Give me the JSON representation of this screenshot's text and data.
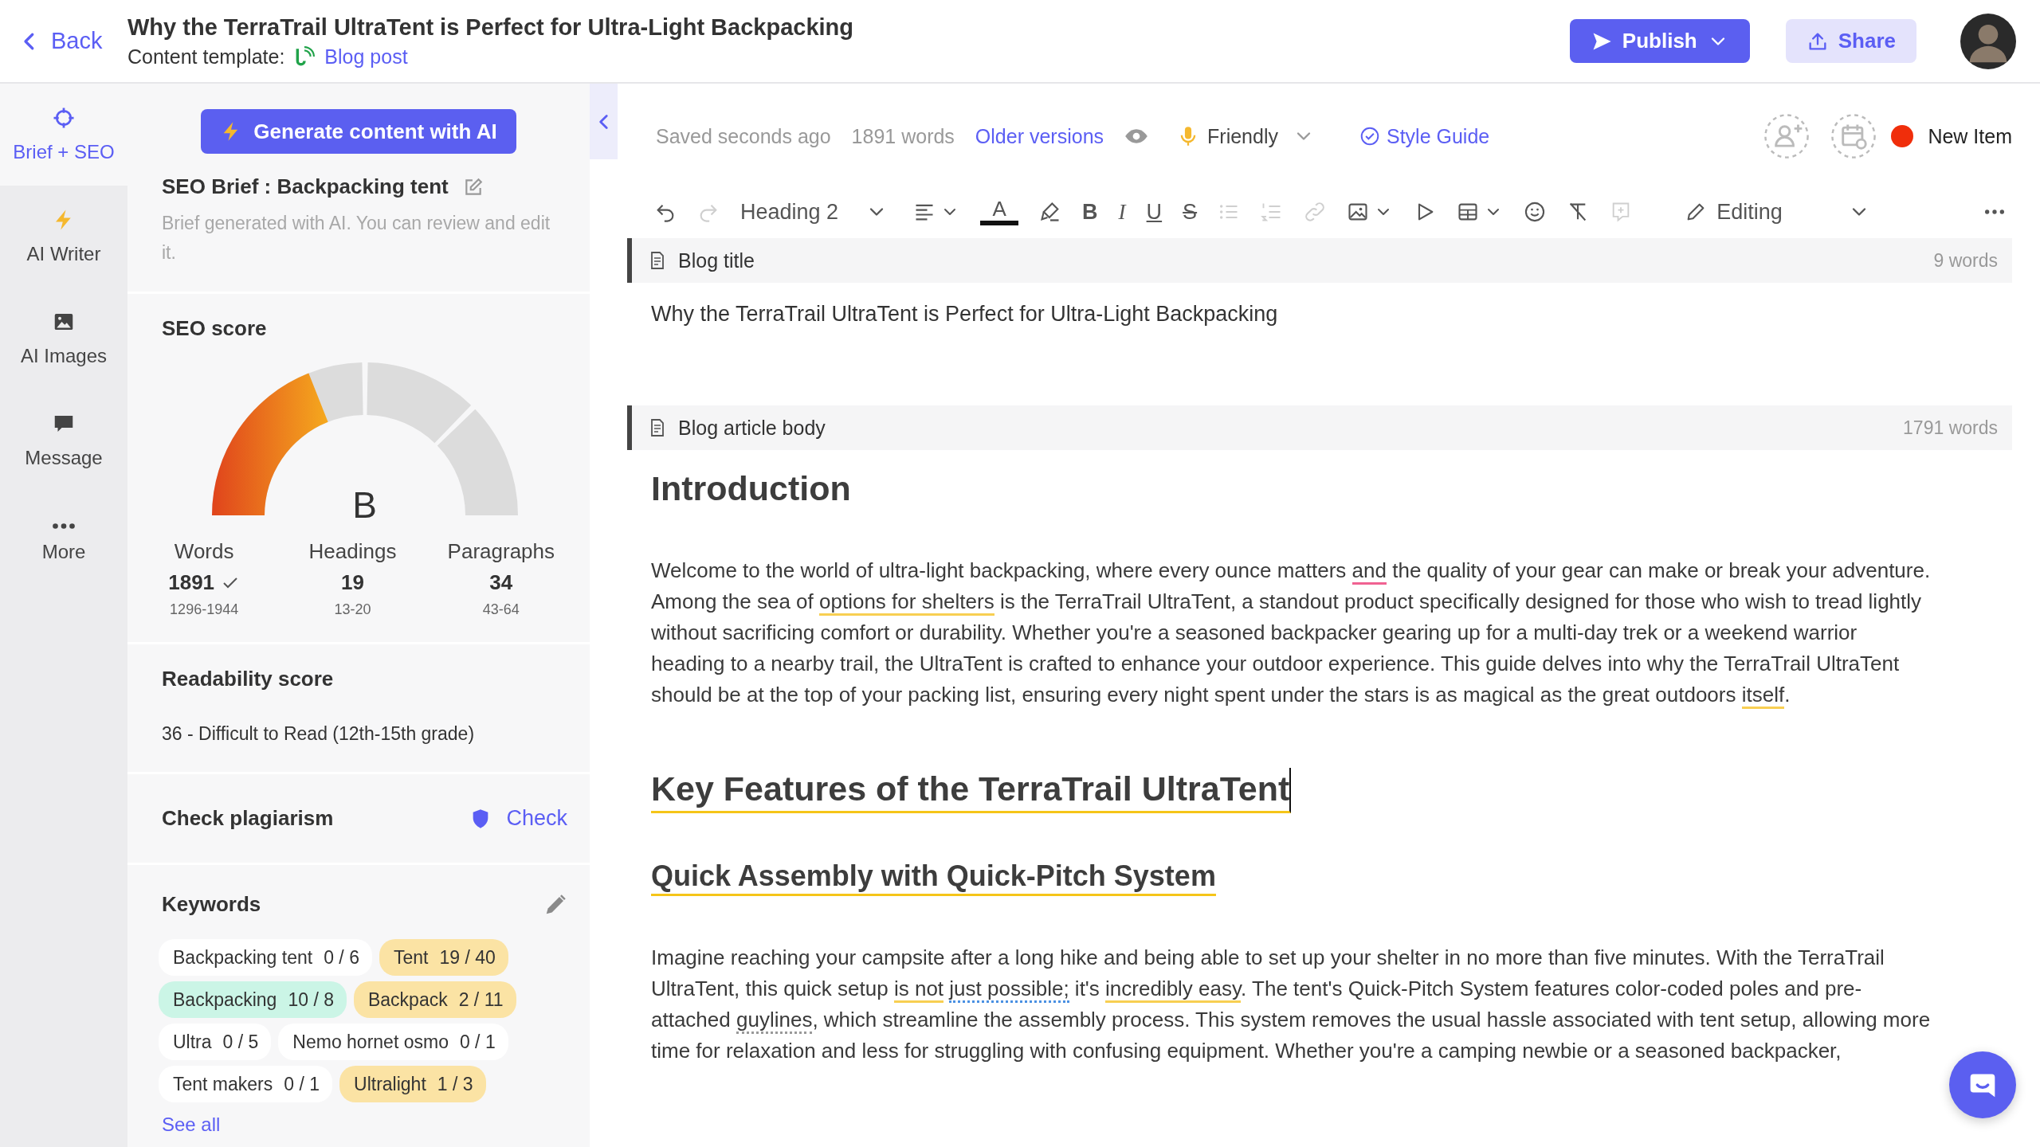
{
  "header": {
    "back": "Back",
    "title": "Why the TerraTrail UltraTent is Perfect for Ultra-Light Backpacking",
    "template_label": "Content template:",
    "template_link": "Blog post",
    "publish": "Publish",
    "share": "Share"
  },
  "rail": [
    {
      "label": "Brief + SEO",
      "selected": true
    },
    {
      "label": "AI Writer",
      "selected": false
    },
    {
      "label": "AI Images",
      "selected": false
    },
    {
      "label": "Message",
      "selected": false
    },
    {
      "label": "More",
      "selected": false
    }
  ],
  "panel": {
    "generate": "Generate content with AI",
    "brief": {
      "title": "SEO Brief : Backpacking tent",
      "description": "Brief generated with AI. You can review and edit it."
    },
    "seo_score": {
      "title": "SEO score",
      "grade": "B",
      "level": 0.38,
      "stats": [
        {
          "label": "Words",
          "value": "1891",
          "range": "1296-1944",
          "met": true
        },
        {
          "label": "Headings",
          "value": "19",
          "range": "13-20",
          "met": false
        },
        {
          "label": "Paragraphs",
          "value": "34",
          "range": "43-64",
          "met": false
        }
      ]
    },
    "readability": {
      "title": "Readability score",
      "text": "36 - Difficult to Read (12th-15th grade)"
    },
    "plagiarism": {
      "title": "Check plagiarism",
      "action": "Check"
    },
    "keywords": {
      "title": "Keywords",
      "see_all": "See all",
      "items": [
        {
          "term": "Backpacking tent",
          "count": "0 / 6",
          "color": "#ffffff"
        },
        {
          "term": "Tent",
          "count": "19 / 40",
          "color": "#fbe3a4"
        },
        {
          "term": "Backpacking",
          "count": "10 / 8",
          "color": "#cbf5e6"
        },
        {
          "term": "Backpack",
          "count": "2 / 11",
          "color": "#fbe3a4"
        },
        {
          "term": "Ultra",
          "count": "0 / 5",
          "color": "#ffffff"
        },
        {
          "term": "Nemo hornet osmo",
          "count": "0 / 1",
          "color": "#ffffff"
        },
        {
          "term": "Tent makers",
          "count": "0 / 1",
          "color": "#ffffff"
        },
        {
          "term": "Ultralight",
          "count": "1 / 3",
          "color": "#fbe3a4"
        }
      ]
    }
  },
  "editor": {
    "status": {
      "saved": "Saved seconds ago",
      "words": "1891 words",
      "versions": "Older versions",
      "tone": "Friendly",
      "style_guide": "Style Guide",
      "item": "New Item"
    },
    "toolbar": [
      {
        "kind": "undo",
        "disabled": false
      },
      {
        "kind": "redo",
        "disabled": true
      },
      {
        "kind": "heading",
        "label": "Heading 2",
        "disabled": false
      },
      {
        "kind": "align",
        "disabled": false
      },
      {
        "kind": "text-color",
        "label": "A",
        "disabled": false
      },
      {
        "kind": "highlight",
        "disabled": false
      },
      {
        "kind": "bold",
        "label": "B",
        "disabled": false
      },
      {
        "kind": "italic",
        "label": "I",
        "disabled": false
      },
      {
        "kind": "underline",
        "label": "U",
        "disabled": false
      },
      {
        "kind": "strike",
        "label": "S",
        "disabled": false
      },
      {
        "kind": "bullet-list",
        "disabled": true
      },
      {
        "kind": "numbered-list",
        "disabled": true
      },
      {
        "kind": "link",
        "disabled": true
      },
      {
        "kind": "image",
        "disabled": false
      },
      {
        "kind": "play",
        "disabled": false
      },
      {
        "kind": "table",
        "disabled": false
      },
      {
        "kind": "emoji",
        "disabled": false
      },
      {
        "kind": "clear-format",
        "disabled": false
      },
      {
        "kind": "comment",
        "disabled": true
      },
      {
        "kind": "mode",
        "label": "Editing",
        "disabled": false
      },
      {
        "kind": "more",
        "disabled": false
      }
    ],
    "blocks": [
      {
        "kind": "section",
        "label": "Blog title",
        "count": "9 words"
      },
      {
        "kind": "title",
        "text": "Why the TerraTrail UltraTent is Perfect for Ultra-Light Backpacking"
      },
      {
        "kind": "section",
        "label": "Blog article body",
        "count": "1791 words"
      },
      {
        "kind": "h1",
        "text": "Introduction",
        "flagged": false,
        "caret": false
      },
      {
        "kind": "p",
        "segments": [
          {
            "kind": "plain",
            "text": "Welcome to the world of ultra-light backpacking, where every ounce matters "
          },
          {
            "kind": "grammar",
            "text": "and"
          },
          {
            "kind": "plain",
            "text": " the quality of your gear can make or break your adventure. Among the sea of "
          },
          {
            "kind": "style",
            "text": "options for shelters"
          },
          {
            "kind": "plain",
            "text": " is the TerraTrail UltraTent, a standout product specifically designed for those who wish to tread lightly without sacrificing comfort or durability. Whether you're a seasoned backpacker gearing up for a multi-day trek or a weekend warrior heading to a nearby trail, the UltraTent is crafted to enhance your outdoor experience. This guide delves into why the TerraTrail UltraTent should be at the top of your packing list, ensuring every night spent under the stars is as magical as the great outdoors "
          },
          {
            "kind": "style",
            "text": "itself"
          },
          {
            "kind": "plain",
            "text": "."
          }
        ]
      },
      {
        "kind": "h1",
        "text": "Key Features of the TerraTrail UltraTent",
        "flagged": true,
        "caret": true
      },
      {
        "kind": "h2",
        "text": "Quick Assembly with Quick-Pitch System",
        "flagged": true,
        "caret": false
      },
      {
        "kind": "p",
        "segments": [
          {
            "kind": "plain",
            "text": "Imagine reaching your campsite after a long hike and being able to set up your shelter in no more than five minutes. With the TerraTrail UltraTent, this quick setup "
          },
          {
            "kind": "style",
            "text": "is not"
          },
          {
            "kind": "spelling",
            "text": "just possible;"
          },
          {
            "kind": "plain",
            "text": " it's "
          },
          {
            "kind": "style",
            "text": "incredibly easy"
          },
          {
            "kind": "plain",
            "text": ". The tent's Quick-Pitch System features color-coded poles and pre-attached "
          },
          {
            "kind": "suggestion",
            "text": "guylines"
          },
          {
            "kind": "plain",
            "text": ", which streamline the assembly process. This system removes the usual hassle associated with tent setup, allowing more time for relaxation and less for struggling with confusing equipment. Whether you're a camping newbie or a seasoned backpacker,"
          }
        ]
      }
    ]
  }
}
